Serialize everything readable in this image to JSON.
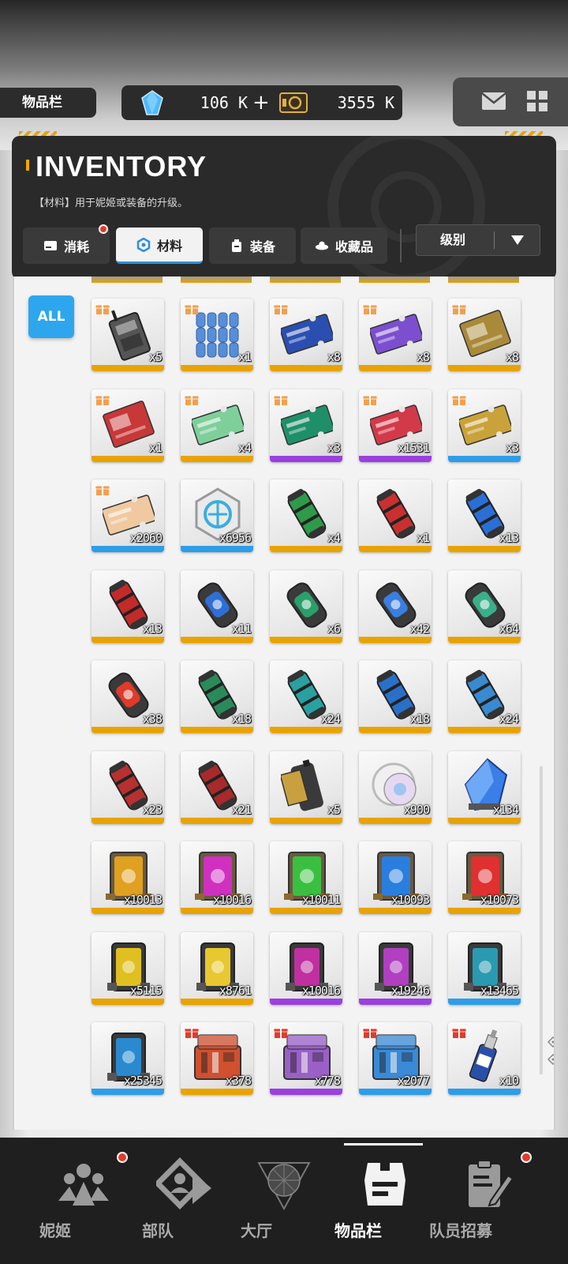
{
  "topbar": {
    "page_label": "物品栏",
    "gems": "106 K",
    "gems_add": "+",
    "credits": "3555 K"
  },
  "inventory": {
    "title": "INVENTORY",
    "description": "【材料】用于妮姬或装备的升级。",
    "tabs": [
      {
        "label": "消耗",
        "icon": "consumable-icon",
        "badge": true,
        "active": false
      },
      {
        "label": "材料",
        "icon": "material-icon",
        "badge": false,
        "active": true
      },
      {
        "label": "装备",
        "icon": "equipment-icon",
        "badge": false,
        "active": false
      },
      {
        "label": "收藏品",
        "icon": "collectible-icon",
        "badge": false,
        "active": false
      }
    ],
    "sort": "级别",
    "filter_all": "ALL"
  },
  "rarity_colors": {
    "SSR": "#e8a300",
    "SR": "#9b3fe0",
    "R": "#2d9de8"
  },
  "items": [
    {
      "name": "radio-item",
      "qty": "x5",
      "rarity": "SSR",
      "gift": true,
      "art": "radio",
      "color": "#555555"
    },
    {
      "name": "water-bottles-item",
      "qty": "x1",
      "rarity": "SSR",
      "gift": true,
      "art": "bottles",
      "color": "#3d7fd6"
    },
    {
      "name": "year-ticket-blue-item",
      "qty": "x8",
      "rarity": "SSR",
      "gift": true,
      "art": "ticket",
      "color": "#2a4fb0"
    },
    {
      "name": "ticket-purple-item",
      "qty": "x8",
      "rarity": "SSR",
      "gift": true,
      "art": "ticket",
      "color": "#7b4fcf"
    },
    {
      "name": "gold-card-item",
      "qty": "x8",
      "rarity": "SSR",
      "gift": true,
      "art": "card",
      "color": "#a88a3a"
    },
    {
      "name": "red-poster-item",
      "qty": "x1",
      "rarity": "SSR",
      "gift": true,
      "art": "card",
      "color": "#c83838"
    },
    {
      "name": "birthday-ticket-item",
      "qty": "x4",
      "rarity": "SSR",
      "gift": true,
      "art": "ticket",
      "color": "#7ecf9a"
    },
    {
      "name": "week-ticket-green-item",
      "qty": "x3",
      "rarity": "SR",
      "gift": true,
      "art": "ticket",
      "color": "#1f8f6a"
    },
    {
      "name": "red-heart-ticket-item",
      "qty": "x1531",
      "rarity": "SR",
      "gift": true,
      "art": "ticket",
      "color": "#d23a4a"
    },
    {
      "name": "day-ticket-gold-item",
      "qty": "x3",
      "rarity": "R",
      "gift": true,
      "art": "ticket",
      "color": "#c9a23a"
    },
    {
      "name": "cream-ticket-item",
      "qty": "x2060",
      "rarity": "R",
      "gift": true,
      "art": "ticket",
      "color": "#f0c9a0"
    },
    {
      "name": "core-module-item",
      "qty": "x6956",
      "rarity": "R",
      "gift": false,
      "art": "hex",
      "color": "#3aaee0"
    },
    {
      "name": "green-canister-item",
      "qty": "x4",
      "rarity": "SSR",
      "gift": false,
      "art": "canister",
      "color": "#2e9a4a"
    },
    {
      "name": "red-canister-item",
      "qty": "x1",
      "rarity": "SSR",
      "gift": false,
      "art": "canister",
      "color": "#c93030"
    },
    {
      "name": "blue-canister-item",
      "qty": "x13",
      "rarity": "SSR",
      "gift": false,
      "art": "canister",
      "color": "#2a6fd6"
    },
    {
      "name": "red-cylinder-item",
      "qty": "x13",
      "rarity": "SSR",
      "gift": false,
      "art": "canister",
      "color": "#c42a2a"
    },
    {
      "name": "blue-capsule-item",
      "qty": "x11",
      "rarity": "SSR",
      "gift": false,
      "art": "capsule",
      "color": "#2f6ed8"
    },
    {
      "name": "green-capsule-item",
      "qty": "x6",
      "rarity": "SSR",
      "gift": false,
      "art": "capsule",
      "color": "#2aa06a"
    },
    {
      "name": "blue-shield-capsule-item",
      "qty": "x42",
      "rarity": "SSR",
      "gift": false,
      "art": "capsule",
      "color": "#3a7ee0"
    },
    {
      "name": "green-flake-capsule-item",
      "qty": "x64",
      "rarity": "SSR",
      "gift": false,
      "art": "capsule",
      "color": "#3ab08a"
    },
    {
      "name": "red-battery-item",
      "qty": "x38",
      "rarity": "SSR",
      "gift": false,
      "art": "capsule",
      "color": "#e03a2a"
    },
    {
      "name": "green-star-cylinder-item",
      "qty": "x18",
      "rarity": "SSR",
      "gift": false,
      "art": "canister",
      "color": "#2a8a5a"
    },
    {
      "name": "teal-gear-cylinder-item",
      "qty": "x24",
      "rarity": "SSR",
      "gift": false,
      "art": "canister",
      "color": "#2aa0a0"
    },
    {
      "name": "blue-burst-cylinder-item",
      "qty": "x18",
      "rarity": "SSR",
      "gift": false,
      "art": "canister",
      "color": "#2a70c8"
    },
    {
      "name": "blue-ring-cylinder-item",
      "qty": "x24",
      "rarity": "SSR",
      "gift": false,
      "art": "canister",
      "color": "#3a8ad0"
    },
    {
      "name": "red-tank-item",
      "qty": "x23",
      "rarity": "SSR",
      "gift": false,
      "art": "canister",
      "color": "#b83030"
    },
    {
      "name": "dark-red-tank-item",
      "qty": "x21",
      "rarity": "SSR",
      "gift": false,
      "art": "canister",
      "color": "#a82a2a"
    },
    {
      "name": "film-roll-item",
      "qty": "x5",
      "rarity": "SSR",
      "gift": false,
      "art": "film",
      "color": "#c9a040"
    },
    {
      "name": "badge-pin-item",
      "qty": "x900",
      "rarity": "SSR",
      "gift": false,
      "art": "badge",
      "color": "#e0e0e0"
    },
    {
      "name": "blue-crystal-item",
      "qty": "x134",
      "rarity": "SSR",
      "gift": false,
      "art": "crystal",
      "color": "#3a7ee8"
    },
    {
      "name": "gold-tablet-item",
      "qty": "x10013",
      "rarity": "SSR",
      "gift": false,
      "art": "tablet",
      "color": "#e0a020"
    },
    {
      "name": "magenta-tablet-item",
      "qty": "x10016",
      "rarity": "SSR",
      "gift": false,
      "art": "tablet",
      "color": "#d030c0"
    },
    {
      "name": "green-tablet-item",
      "qty": "x10011",
      "rarity": "SSR",
      "gift": false,
      "art": "tablet",
      "color": "#3ac040"
    },
    {
      "name": "blue-tablet-item",
      "qty": "x10093",
      "rarity": "SSR",
      "gift": false,
      "art": "tablet",
      "color": "#2a7ee0"
    },
    {
      "name": "red-tablet-item",
      "qty": "x10073",
      "rarity": "SSR",
      "gift": false,
      "art": "tablet",
      "color": "#e03030"
    },
    {
      "name": "yellow-pad-item",
      "qty": "x5115",
      "rarity": "SSR",
      "gift": false,
      "art": "pad",
      "color": "#e0c020"
    },
    {
      "name": "yellow-pad-2-item",
      "qty": "x8761",
      "rarity": "SSR",
      "gift": false,
      "art": "pad",
      "color": "#e8c830"
    },
    {
      "name": "magenta-pad-item",
      "qty": "x10016",
      "rarity": "SR",
      "gift": false,
      "art": "pad",
      "color": "#c030a0"
    },
    {
      "name": "purple-pad-item",
      "qty": "x19246",
      "rarity": "SR",
      "gift": false,
      "art": "pad",
      "color": "#b040c0"
    },
    {
      "name": "teal-pad-item",
      "qty": "x13465",
      "rarity": "R",
      "gift": false,
      "art": "pad",
      "color": "#2a9ab0"
    },
    {
      "name": "blue-pad-item",
      "qty": "x25345",
      "rarity": "R",
      "gift": false,
      "art": "pad",
      "color": "#2a8ad0"
    },
    {
      "name": "orange-toolkit-item",
      "qty": "x378",
      "rarity": "SSR",
      "gift": true,
      "art": "case",
      "color": "#d05030"
    },
    {
      "name": "purple-toolkit-item",
      "qty": "x778",
      "rarity": "SR",
      "gift": true,
      "art": "case",
      "color": "#9a60c8"
    },
    {
      "name": "blue-toolkit-item",
      "qty": "x2077",
      "rarity": "R",
      "gift": true,
      "art": "case",
      "color": "#3a8ad8"
    },
    {
      "name": "glue-bottle-item",
      "qty": "x10",
      "rarity": "R",
      "gift": true,
      "art": "bottle",
      "color": "#2a4fa8"
    }
  ],
  "bottom_nav": [
    {
      "label": "妮姬",
      "icon": "nikke-icon",
      "badge": true,
      "active": false
    },
    {
      "label": "部队",
      "icon": "squad-icon",
      "badge": false,
      "active": false
    },
    {
      "label": "大厅",
      "icon": "lobby-icon",
      "badge": false,
      "active": false
    },
    {
      "label": "物品栏",
      "icon": "inventory-icon",
      "badge": false,
      "active": true
    },
    {
      "label": "队员招募",
      "icon": "recruit-icon",
      "badge": true,
      "active": false
    }
  ]
}
